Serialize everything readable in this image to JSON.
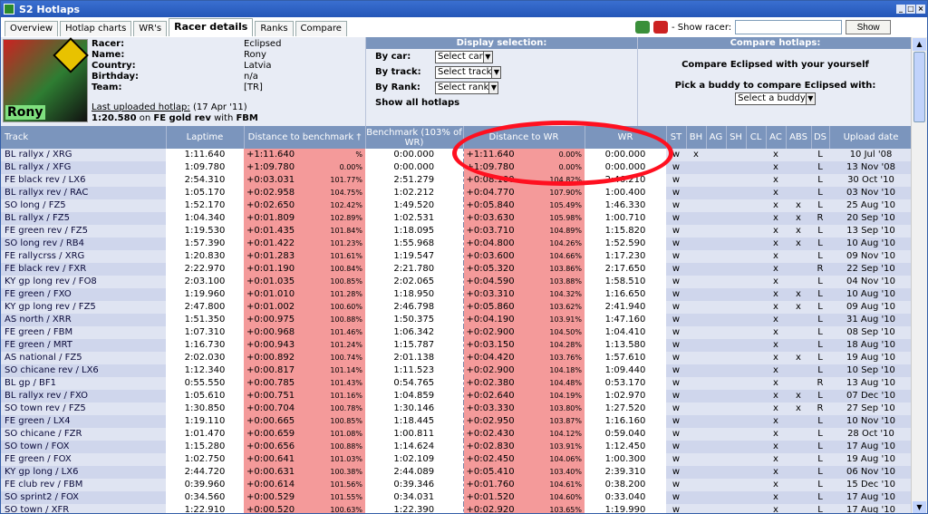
{
  "window": {
    "title": "S2 Hotlaps",
    "btn_min": "_",
    "btn_max": "□",
    "btn_close": "×"
  },
  "tabs": [
    {
      "label": "Overview"
    },
    {
      "label": "Hotlap charts"
    },
    {
      "label": "WR's"
    },
    {
      "label": "Racer details"
    },
    {
      "label": "Ranks"
    },
    {
      "label": "Compare"
    }
  ],
  "show_racer": {
    "label": "- Show racer:",
    "button": "Show",
    "value": ""
  },
  "racer": {
    "avatar_name": "Rony",
    "fields": [
      {
        "k": "Racer:",
        "v": "Eclipsed"
      },
      {
        "k": "Name:",
        "v": "Rony"
      },
      {
        "k": "Country:",
        "v": "Latvia"
      },
      {
        "k": "Birthday:",
        "v": "n/a"
      },
      {
        "k": "Team:",
        "v": "[TR]"
      }
    ],
    "last_label": "Last uploaded hotlap:",
    "last_date": "(17 Apr '11)",
    "last_time": "1:20.580",
    "last_on": "on",
    "last_track": "FE gold rev",
    "last_with": "with",
    "last_car": "FBM"
  },
  "display_selection": {
    "title": "Display selection:",
    "by_car": "By car:",
    "car": "Select car",
    "by_track": "By track:",
    "track": "Select track",
    "by_rank": "By Rank:",
    "rank": "Select rank",
    "show_all": "Show all hotlaps"
  },
  "compare": {
    "title": "Compare hotlaps:",
    "self": "Compare Eclipsed with your yourself",
    "buddy_label": "Pick a buddy to compare Eclipsed with:",
    "buddy": "Select a buddy"
  },
  "columns": {
    "track": "Track",
    "laptime": "Laptime",
    "dist_bm": "Distance to benchmark †",
    "bm": "Benchmark (103% of WR)",
    "dist_wr": "Distance to WR",
    "wr": "WR",
    "st": "ST",
    "bh": "BH",
    "ag": "AG",
    "sh": "SH",
    "cl": "CL",
    "ac": "AC",
    "abs": "ABS",
    "ds": "DS",
    "up": "Upload date"
  },
  "rows": [
    {
      "track": "BL rallyx / XRG",
      "lap": "1:11.640",
      "dbm": "+1:11.640",
      "pbm": "%",
      "bm": "0:00.000",
      "dwr": "+1:11.640",
      "pwr": "0.00%",
      "wr": "0:00.000",
      "st": "w",
      "bh": "x",
      "ac": "x",
      "abs": "",
      "ds": "L",
      "up": "10 Jul '08"
    },
    {
      "track": "BL rallyx / XFG",
      "lap": "1:09.780",
      "dbm": "+1:09.780",
      "pbm": "0.00%",
      "bm": "0:00.000",
      "dwr": "+1:09.780",
      "pwr": "0.00%",
      "wr": "0:00.000",
      "st": "w",
      "bh": "",
      "ac": "x",
      "abs": "",
      "ds": "L",
      "up": "13 Nov '08"
    },
    {
      "track": "FE black rev / LX6",
      "lap": "2:54.310",
      "dbm": "+0:03.031",
      "pbm": "101.77%",
      "bm": "2:51.279",
      "dwr": "+0:08.100",
      "pwr": "104.82%",
      "wr": "2:46.210",
      "st": "w",
      "bh": "",
      "ac": "x",
      "abs": "",
      "ds": "L",
      "up": "30 Oct '10"
    },
    {
      "track": "BL rallyx rev / RAC",
      "lap": "1:05.170",
      "dbm": "+0:02.958",
      "pbm": "104.75%",
      "bm": "1:02.212",
      "dwr": "+0:04.770",
      "pwr": "107.90%",
      "wr": "1:00.400",
      "st": "w",
      "bh": "",
      "ac": "x",
      "abs": "",
      "ds": "L",
      "up": "03 Nov '10"
    },
    {
      "track": "SO long / FZ5",
      "lap": "1:52.170",
      "dbm": "+0:02.650",
      "pbm": "102.42%",
      "bm": "1:49.520",
      "dwr": "+0:05.840",
      "pwr": "105.49%",
      "wr": "1:46.330",
      "st": "w",
      "bh": "",
      "ac": "x",
      "abs": "x",
      "ds": "L",
      "up": "25 Aug '10"
    },
    {
      "track": "BL rallyx / FZ5",
      "lap": "1:04.340",
      "dbm": "+0:01.809",
      "pbm": "102.89%",
      "bm": "1:02.531",
      "dwr": "+0:03.630",
      "pwr": "105.98%",
      "wr": "1:00.710",
      "st": "w",
      "bh": "",
      "ac": "x",
      "abs": "x",
      "ds": "R",
      "up": "20 Sep '10"
    },
    {
      "track": "FE green rev / FZ5",
      "lap": "1:19.530",
      "dbm": "+0:01.435",
      "pbm": "101.84%",
      "bm": "1:18.095",
      "dwr": "+0:03.710",
      "pwr": "104.89%",
      "wr": "1:15.820",
      "st": "w",
      "bh": "",
      "ac": "x",
      "abs": "x",
      "ds": "L",
      "up": "13 Sep '10"
    },
    {
      "track": "SO long rev / RB4",
      "lap": "1:57.390",
      "dbm": "+0:01.422",
      "pbm": "101.23%",
      "bm": "1:55.968",
      "dwr": "+0:04.800",
      "pwr": "104.26%",
      "wr": "1:52.590",
      "st": "w",
      "bh": "",
      "ac": "x",
      "abs": "x",
      "ds": "L",
      "up": "10 Aug '10"
    },
    {
      "track": "FE rallycrss / XRG",
      "lap": "1:20.830",
      "dbm": "+0:01.283",
      "pbm": "101.61%",
      "bm": "1:19.547",
      "dwr": "+0:03.600",
      "pwr": "104.66%",
      "wr": "1:17.230",
      "st": "w",
      "bh": "",
      "ac": "x",
      "abs": "",
      "ds": "L",
      "up": "09 Nov '10"
    },
    {
      "track": "FE black rev / FXR",
      "lap": "2:22.970",
      "dbm": "+0:01.190",
      "pbm": "100.84%",
      "bm": "2:21.780",
      "dwr": "+0:05.320",
      "pwr": "103.86%",
      "wr": "2:17.650",
      "st": "w",
      "bh": "",
      "ac": "x",
      "abs": "",
      "ds": "R",
      "up": "22 Sep '10"
    },
    {
      "track": "KY gp long rev / FO8",
      "lap": "2:03.100",
      "dbm": "+0:01.035",
      "pbm": "100.85%",
      "bm": "2:02.065",
      "dwr": "+0:04.590",
      "pwr": "103.88%",
      "wr": "1:58.510",
      "st": "w",
      "bh": "",
      "ac": "x",
      "abs": "",
      "ds": "L",
      "up": "04 Nov '10"
    },
    {
      "track": "FE green / FXO",
      "lap": "1:19.960",
      "dbm": "+0:01.010",
      "pbm": "101.28%",
      "bm": "1:18.950",
      "dwr": "+0:03.310",
      "pwr": "104.32%",
      "wr": "1:16.650",
      "st": "w",
      "bh": "",
      "ac": "x",
      "abs": "x",
      "ds": "L",
      "up": "10 Aug '10"
    },
    {
      "track": "KY gp long rev / FZ5",
      "lap": "2:47.800",
      "dbm": "+0:01.002",
      "pbm": "100.60%",
      "bm": "2:46.798",
      "dwr": "+0:05.860",
      "pwr": "103.62%",
      "wr": "2:41.940",
      "st": "w",
      "bh": "",
      "ac": "x",
      "abs": "x",
      "ds": "L",
      "up": "09 Aug '10"
    },
    {
      "track": "AS north / XRR",
      "lap": "1:51.350",
      "dbm": "+0:00.975",
      "pbm": "100.88%",
      "bm": "1:50.375",
      "dwr": "+0:04.190",
      "pwr": "103.91%",
      "wr": "1:47.160",
      "st": "w",
      "bh": "",
      "ac": "x",
      "abs": "",
      "ds": "L",
      "up": "31 Aug '10"
    },
    {
      "track": "FE green / FBM",
      "lap": "1:07.310",
      "dbm": "+0:00.968",
      "pbm": "101.46%",
      "bm": "1:06.342",
      "dwr": "+0:02.900",
      "pwr": "104.50%",
      "wr": "1:04.410",
      "st": "w",
      "bh": "",
      "ac": "x",
      "abs": "",
      "ds": "L",
      "up": "08 Sep '10"
    },
    {
      "track": "FE green / MRT",
      "lap": "1:16.730",
      "dbm": "+0:00.943",
      "pbm": "101.24%",
      "bm": "1:15.787",
      "dwr": "+0:03.150",
      "pwr": "104.28%",
      "wr": "1:13.580",
      "st": "w",
      "bh": "",
      "ac": "x",
      "abs": "",
      "ds": "L",
      "up": "18 Aug '10"
    },
    {
      "track": "AS national / FZ5",
      "lap": "2:02.030",
      "dbm": "+0:00.892",
      "pbm": "100.74%",
      "bm": "2:01.138",
      "dwr": "+0:04.420",
      "pwr": "103.76%",
      "wr": "1:57.610",
      "st": "w",
      "bh": "",
      "ac": "x",
      "abs": "x",
      "ds": "L",
      "up": "19 Aug '10"
    },
    {
      "track": "SO chicane rev / LX6",
      "lap": "1:12.340",
      "dbm": "+0:00.817",
      "pbm": "101.14%",
      "bm": "1:11.523",
      "dwr": "+0:02.900",
      "pwr": "104.18%",
      "wr": "1:09.440",
      "st": "w",
      "bh": "",
      "ac": "x",
      "abs": "",
      "ds": "L",
      "up": "10 Sep '10"
    },
    {
      "track": "BL gp / BF1",
      "lap": "0:55.550",
      "dbm": "+0:00.785",
      "pbm": "101.43%",
      "bm": "0:54.765",
      "dwr": "+0:02.380",
      "pwr": "104.48%",
      "wr": "0:53.170",
      "st": "w",
      "bh": "",
      "ac": "x",
      "abs": "",
      "ds": "R",
      "up": "13 Aug '10"
    },
    {
      "track": "BL rallyx rev / FXO",
      "lap": "1:05.610",
      "dbm": "+0:00.751",
      "pbm": "101.16%",
      "bm": "1:04.859",
      "dwr": "+0:02.640",
      "pwr": "104.19%",
      "wr": "1:02.970",
      "st": "w",
      "bh": "",
      "ac": "x",
      "abs": "x",
      "ds": "L",
      "up": "07 Dec '10"
    },
    {
      "track": "SO town rev / FZ5",
      "lap": "1:30.850",
      "dbm": "+0:00.704",
      "pbm": "100.78%",
      "bm": "1:30.146",
      "dwr": "+0:03.330",
      "pwr": "103.80%",
      "wr": "1:27.520",
      "st": "w",
      "bh": "",
      "ac": "x",
      "abs": "x",
      "ds": "R",
      "up": "27 Sep '10"
    },
    {
      "track": "FE green / LX4",
      "lap": "1:19.110",
      "dbm": "+0:00.665",
      "pbm": "100.85%",
      "bm": "1:18.445",
      "dwr": "+0:02.950",
      "pwr": "103.87%",
      "wr": "1:16.160",
      "st": "w",
      "bh": "",
      "ac": "x",
      "abs": "",
      "ds": "L",
      "up": "10 Nov '10"
    },
    {
      "track": "SO chicane / FZR",
      "lap": "1:01.470",
      "dbm": "+0:00.659",
      "pbm": "101.08%",
      "bm": "1:00.811",
      "dwr": "+0:02.430",
      "pwr": "104.12%",
      "wr": "0:59.040",
      "st": "w",
      "bh": "",
      "ac": "x",
      "abs": "",
      "ds": "L",
      "up": "28 Oct '10"
    },
    {
      "track": "SO town / FOX",
      "lap": "1:15.280",
      "dbm": "+0:00.656",
      "pbm": "100.88%",
      "bm": "1:14.624",
      "dwr": "+0:02.830",
      "pwr": "103.91%",
      "wr": "1:12.450",
      "st": "w",
      "bh": "",
      "ac": "x",
      "abs": "",
      "ds": "L",
      "up": "17 Aug '10"
    },
    {
      "track": "FE green / FOX",
      "lap": "1:02.750",
      "dbm": "+0:00.641",
      "pbm": "101.03%",
      "bm": "1:02.109",
      "dwr": "+0:02.450",
      "pwr": "104.06%",
      "wr": "1:00.300",
      "st": "w",
      "bh": "",
      "ac": "x",
      "abs": "",
      "ds": "L",
      "up": "19 Aug '10"
    },
    {
      "track": "KY gp long / LX6",
      "lap": "2:44.720",
      "dbm": "+0:00.631",
      "pbm": "100.38%",
      "bm": "2:44.089",
      "dwr": "+0:05.410",
      "pwr": "103.40%",
      "wr": "2:39.310",
      "st": "w",
      "bh": "",
      "ac": "x",
      "abs": "",
      "ds": "L",
      "up": "06 Nov '10"
    },
    {
      "track": "FE club rev / FBM",
      "lap": "0:39.960",
      "dbm": "+0:00.614",
      "pbm": "101.56%",
      "bm": "0:39.346",
      "dwr": "+0:01.760",
      "pwr": "104.61%",
      "wr": "0:38.200",
      "st": "w",
      "bh": "",
      "ac": "x",
      "abs": "",
      "ds": "L",
      "up": "15 Dec '10"
    },
    {
      "track": "SO sprint2 / FOX",
      "lap": "0:34.560",
      "dbm": "+0:00.529",
      "pbm": "101.55%",
      "bm": "0:34.031",
      "dwr": "+0:01.520",
      "pwr": "104.60%",
      "wr": "0:33.040",
      "st": "w",
      "bh": "",
      "ac": "x",
      "abs": "",
      "ds": "L",
      "up": "17 Aug '10"
    },
    {
      "track": "SO town / XFR",
      "lap": "1:22.910",
      "dbm": "+0:00.520",
      "pbm": "100.63%",
      "bm": "1:22.390",
      "dwr": "+0:02.920",
      "pwr": "103.65%",
      "wr": "1:19.990",
      "st": "w",
      "bh": "",
      "ac": "x",
      "abs": "",
      "ds": "L",
      "up": "17 Aug '10"
    }
  ]
}
